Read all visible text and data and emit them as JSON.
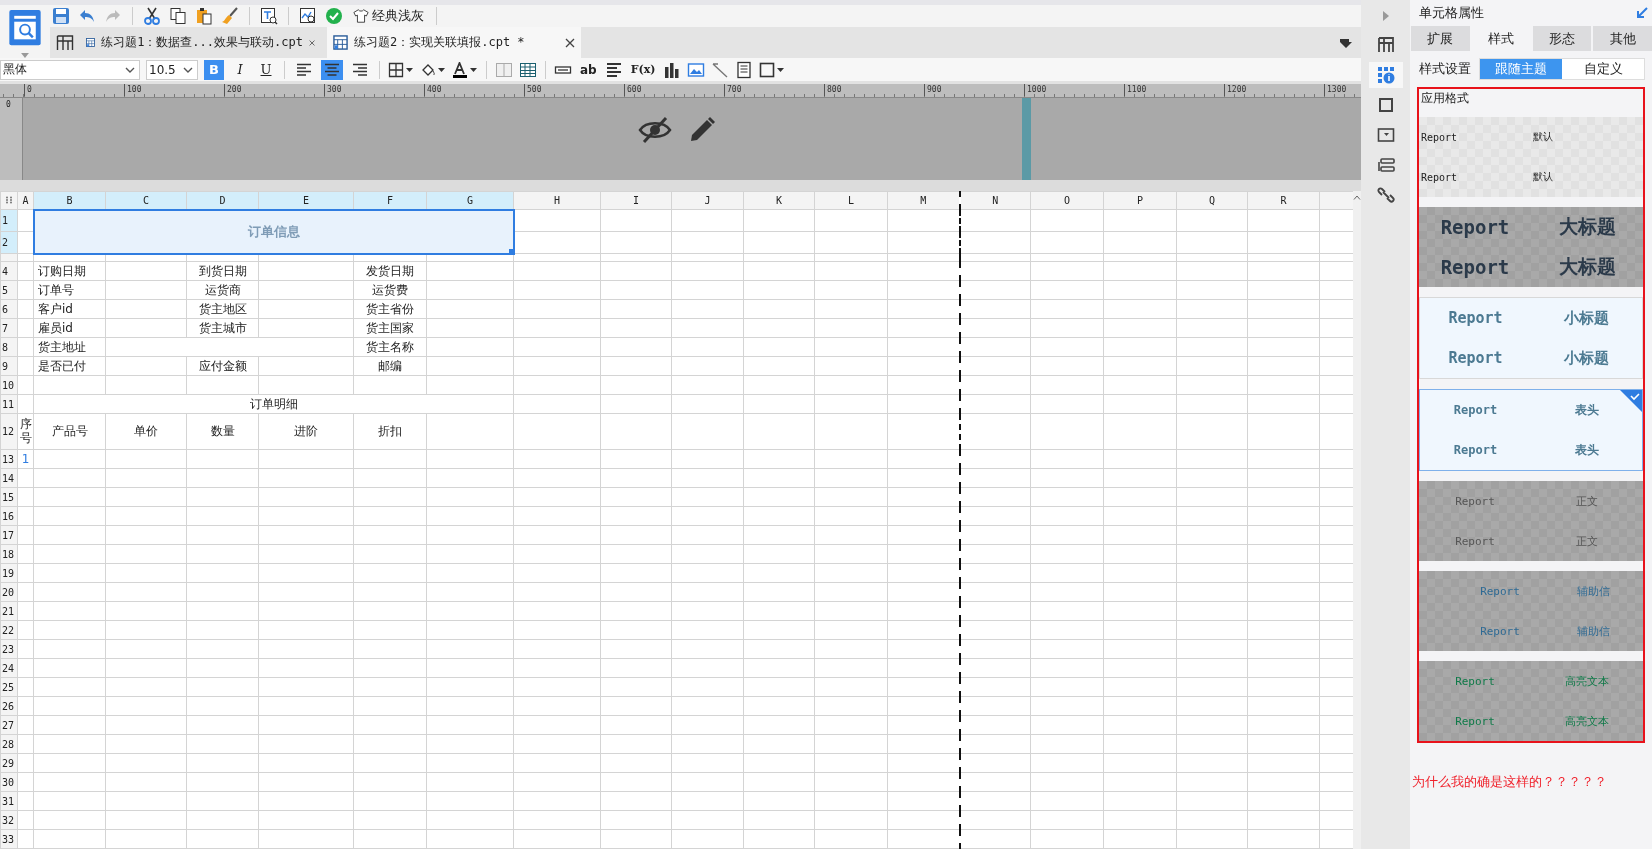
{
  "toolbar": {
    "theme_label": "经典浅灰"
  },
  "doc_tabs": [
    {
      "label": "练习题1：数据查...效果与联动.cpt",
      "selected": false
    },
    {
      "label": "练习题2：实现关联填报.cpt *",
      "selected": true
    }
  ],
  "format_bar": {
    "font": "黑体",
    "size": "10.5",
    "styles": [
      {
        "kind": "bold",
        "label": "B",
        "on": true
      },
      {
        "kind": "italic",
        "label": "I",
        "on": false
      },
      {
        "kind": "underline",
        "label": "U",
        "on": false
      }
    ],
    "align": [
      {
        "kind": "left",
        "selected": false
      },
      {
        "kind": "center",
        "selected": true
      },
      {
        "kind": "right",
        "selected": false
      }
    ],
    "text_tool": "ab",
    "formula_tool": "F(x)"
  },
  "ruler": {
    "ticks": [
      "0",
      "100",
      "200",
      "300",
      "400",
      "500",
      "600",
      "700",
      "800",
      "900",
      "1000",
      "1100",
      "1200",
      "1300"
    ],
    "side_label": "0"
  },
  "sheet": {
    "columns": [
      {
        "label": "A",
        "selected": false
      },
      {
        "label": "B",
        "selected": true
      },
      {
        "label": "C",
        "selected": true
      },
      {
        "label": "D",
        "selected": true
      },
      {
        "label": "E",
        "selected": true
      },
      {
        "label": "F",
        "selected": true
      },
      {
        "label": "G",
        "selected": true
      },
      {
        "label": "H",
        "selected": false
      },
      {
        "label": "I",
        "selected": false
      },
      {
        "label": "J",
        "selected": false
      },
      {
        "label": "K",
        "selected": false
      },
      {
        "label": "L",
        "selected": false
      },
      {
        "label": "M",
        "selected": false
      },
      {
        "label": "N",
        "selected": false,
        "page_break_before": true
      },
      {
        "label": "O",
        "selected": false
      },
      {
        "label": "P",
        "selected": false
      },
      {
        "label": "Q",
        "selected": false
      },
      {
        "label": "R",
        "selected": false
      },
      {}
    ],
    "rows": [
      {
        "label": "1",
        "kind": "title",
        "selected": true,
        "cells": [
          null,
          {
            "text": "订单信息",
            "kind": "title",
            "selected": true
          }
        ]
      },
      {
        "label": "2",
        "kind": "title",
        "selected": true,
        "cells": [
          null,
          {
            "kind": "covered"
          }
        ]
      },
      {
        "kind": "spacer"
      },
      {
        "label": "4",
        "selected": false,
        "cells": [
          null,
          {
            "text": "订购日期",
            "kind": "label"
          },
          null,
          {
            "text": "到货日期",
            "kind": "center"
          },
          null,
          {
            "text": "发货日期",
            "kind": "center"
          }
        ]
      },
      {
        "label": "5",
        "selected": false,
        "cells": [
          null,
          {
            "text": "订单号",
            "kind": "label"
          },
          null,
          {
            "text": "运货商",
            "kind": "center"
          },
          null,
          {
            "text": "运货费",
            "kind": "center"
          }
        ]
      },
      {
        "label": "6",
        "selected": false,
        "cells": [
          null,
          {
            "text": "客户id",
            "kind": "label"
          },
          null,
          {
            "text": "货主地区",
            "kind": "center"
          },
          null,
          {
            "text": "货主省份",
            "kind": "center"
          }
        ]
      },
      {
        "label": "7",
        "selected": false,
        "cells": [
          null,
          {
            "text": "雇员id",
            "kind": "label"
          },
          null,
          {
            "text": "货主城市",
            "kind": "center"
          },
          null,
          {
            "text": "货主国家",
            "kind": "center"
          }
        ]
      },
      {
        "label": "8",
        "selected": false,
        "cells": [
          null,
          {
            "text": "货主地址",
            "kind": "label"
          },
          {
            "kind": "wide"
          },
          {
            "text": "货主名称",
            "kind": "center"
          }
        ]
      },
      {
        "label": "9",
        "selected": false,
        "cells": [
          null,
          {
            "text": "是否已付",
            "kind": "label"
          },
          null,
          {
            "text": "应付金额",
            "kind": "center"
          },
          null,
          {
            "text": "邮编",
            "kind": "center"
          }
        ]
      },
      {
        "label": "10",
        "selected": false
      },
      {
        "label": "11",
        "selected": false,
        "cells": [
          null,
          {
            "text": "订单明细",
            "kind": "section"
          }
        ]
      },
      {
        "label": "12",
        "kind": "tall",
        "selected": false,
        "cells": [
          {
            "text": "序号",
            "kind": "vertical"
          },
          {
            "text": "产品号",
            "kind": "center"
          },
          {
            "text": "单价",
            "kind": "center"
          },
          {
            "text": "数量",
            "kind": "center"
          },
          {
            "text": "进阶",
            "kind": "center"
          },
          {
            "text": "折扣",
            "kind": "center"
          }
        ]
      },
      {
        "label": "13",
        "selected": false,
        "cells": [
          {
            "text": "1",
            "kind": "index"
          }
        ]
      },
      {
        "label": "14",
        "selected": false
      },
      {
        "label": "15",
        "selected": false
      },
      {
        "label": "16",
        "selected": false
      },
      {
        "label": "17",
        "selected": false
      },
      {
        "label": "18",
        "selected": false
      },
      {
        "label": "19",
        "selected": false
      },
      {
        "label": "20",
        "selected": false
      },
      {
        "label": "21",
        "selected": false
      },
      {
        "label": "22",
        "selected": false
      },
      {
        "label": "23",
        "selected": false
      },
      {
        "label": "24",
        "selected": false
      },
      {
        "label": "25",
        "selected": false
      },
      {
        "label": "26",
        "selected": false
      },
      {
        "label": "27",
        "selected": false
      },
      {
        "label": "28",
        "selected": false
      },
      {
        "label": "29",
        "selected": false
      },
      {
        "label": "30",
        "selected": false
      },
      {
        "label": "31",
        "selected": false
      },
      {
        "label": "32",
        "selected": false
      },
      {
        "label": "33",
        "selected": false
      }
    ]
  },
  "side_strip": [
    {
      "selected": false
    },
    {
      "selected": true
    },
    {
      "selected": false
    },
    {
      "selected": false
    },
    {
      "selected": false
    },
    {
      "selected": false
    }
  ],
  "panel": {
    "title": "单元格属性",
    "tabs": [
      {
        "label": "扩展",
        "selected": false
      },
      {
        "label": "样式",
        "selected": true
      },
      {
        "label": "形态",
        "selected": false
      },
      {
        "label": "其他",
        "selected": false
      }
    ],
    "style_label": "样式设置",
    "style_modes": [
      {
        "label": "跟随主题",
        "selected": true
      },
      {
        "label": "自定义",
        "selected": false
      }
    ],
    "apply_label": "应用格式",
    "presets": [
      {
        "kind": "default",
        "selected": false,
        "rows": [
          [
            "Report",
            "默认"
          ],
          [
            "Report",
            "默认"
          ]
        ]
      },
      {
        "kind": "big_title",
        "selected": false,
        "rows": [
          [
            "Report",
            "大标题"
          ],
          [
            "Report",
            "大标题"
          ]
        ]
      },
      {
        "kind": "small_title",
        "selected": false,
        "rows": [
          [
            "Report",
            "小标题"
          ],
          [
            "Report",
            "小标题"
          ]
        ]
      },
      {
        "kind": "header",
        "selected": true,
        "rows": [
          [
            "Report",
            "表头"
          ],
          [
            "Report",
            "表头"
          ]
        ]
      },
      {
        "kind": "body",
        "selected": false,
        "rows": [
          [
            "Report",
            "正文"
          ],
          [
            "Report",
            "正文"
          ]
        ]
      },
      {
        "kind": "aux",
        "selected": false,
        "rows": [
          [
            "Report",
            "辅助信"
          ],
          [
            "Report",
            "辅助信"
          ]
        ]
      },
      {
        "kind": "highlight",
        "selected": false,
        "rows": [
          [
            "Report",
            "高亮文本"
          ],
          [
            "Report",
            "高亮文本"
          ]
        ]
      }
    ]
  },
  "note": "为什么我的确是这样的？？？？？"
}
